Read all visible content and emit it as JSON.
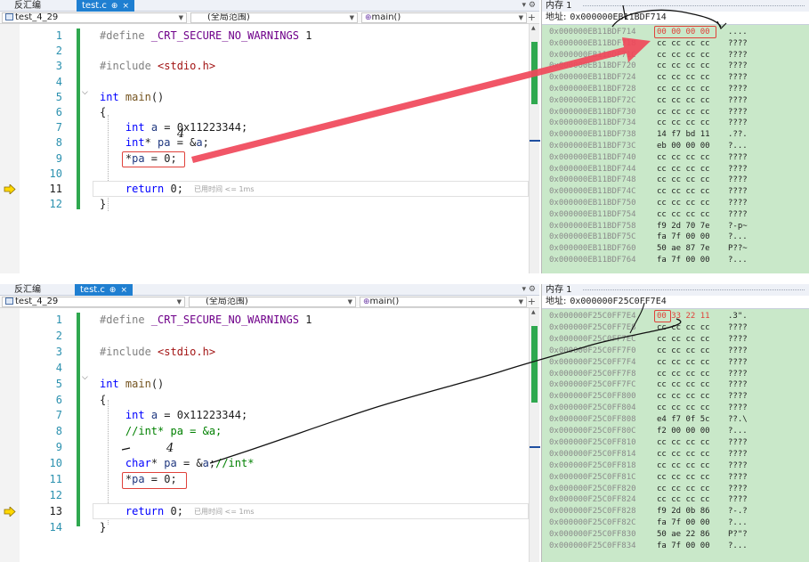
{
  "panels": [
    {
      "tabs": {
        "left_label": "反汇编",
        "file_label": "test.c",
        "pin_glyph": "⊕",
        "close_glyph": "×"
      },
      "nav": {
        "project": "test_4_29",
        "scope": "(全局范围)",
        "function": "main()"
      },
      "lines": [
        {
          "n": "1",
          "segments": [
            [
              "pp",
              "#define "
            ],
            [
              "mac",
              "_CRT_SECURE_NO_WARNINGS"
            ],
            [
              "plain",
              " 1"
            ]
          ]
        },
        {
          "n": "2",
          "segments": []
        },
        {
          "n": "3",
          "segments": [
            [
              "pp",
              "#include "
            ],
            [
              "inc",
              "<stdio.h>"
            ]
          ]
        },
        {
          "n": "4",
          "segments": []
        },
        {
          "n": "5",
          "segments": [
            [
              "kw",
              "int"
            ],
            [
              "plain",
              " "
            ],
            [
              "fn",
              "main"
            ],
            [
              "plain",
              "()"
            ]
          ]
        },
        {
          "n": "6",
          "segments": [
            [
              "plain",
              "{"
            ]
          ]
        },
        {
          "n": "7",
          "segments": [
            [
              "plain",
              "    "
            ],
            [
              "kw",
              "int"
            ],
            [
              "plain",
              " "
            ],
            [
              "var",
              "a"
            ],
            [
              "plain",
              " = 0x11223344;"
            ]
          ]
        },
        {
          "n": "8",
          "segments": [
            [
              "plain",
              "    "
            ],
            [
              "kw",
              "int"
            ],
            [
              "plain",
              "* "
            ],
            [
              "var",
              "pa"
            ],
            [
              "plain",
              " = &"
            ],
            [
              "var",
              "a"
            ],
            [
              "plain",
              ";"
            ]
          ]
        },
        {
          "n": "9",
          "segments": [
            [
              "plain",
              "    *"
            ],
            [
              "var",
              "pa"
            ],
            [
              "plain",
              " = 0;"
            ]
          ]
        },
        {
          "n": "10",
          "segments": []
        },
        {
          "n": "11",
          "segments": [
            [
              "plain",
              "    "
            ],
            [
              "kw",
              "return"
            ],
            [
              "plain",
              " 0;"
            ]
          ],
          "hint": "已用时间 <= 1ms"
        },
        {
          "n": "12",
          "segments": [
            [
              "plain",
              "}"
            ]
          ]
        }
      ],
      "memory": {
        "title": "内存 1",
        "address_label": "地址:",
        "address": "0x000000EB11BDF714",
        "rows": [
          {
            "addr": "0x000000EB11BDF714",
            "bytes": "00 00 00 00",
            "chars": "...."
          },
          {
            "addr": "0x000000EB11BDF718",
            "bytes": "cc cc cc cc",
            "chars": "????"
          },
          {
            "addr": "0x000000EB11BDF71C",
            "bytes": "cc cc cc cc",
            "chars": "????"
          },
          {
            "addr": "0x000000EB11BDF720",
            "bytes": "cc cc cc cc",
            "chars": "????"
          },
          {
            "addr": "0x000000EB11BDF724",
            "bytes": "cc cc cc cc",
            "chars": "????"
          },
          {
            "addr": "0x000000EB11BDF728",
            "bytes": "cc cc cc cc",
            "chars": "????"
          },
          {
            "addr": "0x000000EB11BDF72C",
            "bytes": "cc cc cc cc",
            "chars": "????"
          },
          {
            "addr": "0x000000EB11BDF730",
            "bytes": "cc cc cc cc",
            "chars": "????"
          },
          {
            "addr": "0x000000EB11BDF734",
            "bytes": "cc cc cc cc",
            "chars": "????"
          },
          {
            "addr": "0x000000EB11BDF738",
            "bytes": "14 f7 bd 11",
            "chars": ".??."
          },
          {
            "addr": "0x000000EB11BDF73C",
            "bytes": "eb 00 00 00",
            "chars": "?..."
          },
          {
            "addr": "0x000000EB11BDF740",
            "bytes": "cc cc cc cc",
            "chars": "????"
          },
          {
            "addr": "0x000000EB11BDF744",
            "bytes": "cc cc cc cc",
            "chars": "????"
          },
          {
            "addr": "0x000000EB11BDF748",
            "bytes": "cc cc cc cc",
            "chars": "????"
          },
          {
            "addr": "0x000000EB11BDF74C",
            "bytes": "cc cc cc cc",
            "chars": "????"
          },
          {
            "addr": "0x000000EB11BDF750",
            "bytes": "cc cc cc cc",
            "chars": "????"
          },
          {
            "addr": "0x000000EB11BDF754",
            "bytes": "cc cc cc cc",
            "chars": "????"
          },
          {
            "addr": "0x000000EB11BDF758",
            "bytes": "f9 2d 70 7e",
            "chars": "?-p~"
          },
          {
            "addr": "0x000000EB11BDF75C",
            "bytes": "fa 7f 00 00",
            "chars": "?..."
          },
          {
            "addr": "0x000000EB11BDF760",
            "bytes": "50 ae 87 7e",
            "chars": "P??~"
          },
          {
            "addr": "0x000000EB11BDF764",
            "bytes": "fa 7f 00 00",
            "chars": "?..."
          }
        ]
      },
      "annotation_digit": "4"
    },
    {
      "tabs": {
        "left_label": "反汇编",
        "file_label": "test.c",
        "pin_glyph": "⊕",
        "close_glyph": "×"
      },
      "nav": {
        "project": "test_4_29",
        "scope": "(全局范围)",
        "function": "main()"
      },
      "lines": [
        {
          "n": "1",
          "segments": [
            [
              "pp",
              "#define "
            ],
            [
              "mac",
              "_CRT_SECURE_NO_WARNINGS"
            ],
            [
              "plain",
              " 1"
            ]
          ]
        },
        {
          "n": "2",
          "segments": []
        },
        {
          "n": "3",
          "segments": [
            [
              "pp",
              "#include "
            ],
            [
              "inc",
              "<stdio.h>"
            ]
          ]
        },
        {
          "n": "4",
          "segments": []
        },
        {
          "n": "5",
          "segments": [
            [
              "kw",
              "int"
            ],
            [
              "plain",
              " "
            ],
            [
              "fn",
              "main"
            ],
            [
              "plain",
              "()"
            ]
          ]
        },
        {
          "n": "6",
          "segments": [
            [
              "plain",
              "{"
            ]
          ]
        },
        {
          "n": "7",
          "segments": [
            [
              "plain",
              "    "
            ],
            [
              "kw",
              "int"
            ],
            [
              "plain",
              " "
            ],
            [
              "var",
              "a"
            ],
            [
              "plain",
              " = 0x11223344;"
            ]
          ]
        },
        {
          "n": "8",
          "segments": [
            [
              "plain",
              "    "
            ],
            [
              "cm",
              "//int* pa = &a;"
            ]
          ]
        },
        {
          "n": "9",
          "segments": []
        },
        {
          "n": "10",
          "segments": [
            [
              "plain",
              "    "
            ],
            [
              "kw",
              "char"
            ],
            [
              "plain",
              "* "
            ],
            [
              "var",
              "pa"
            ],
            [
              "plain",
              " = &"
            ],
            [
              "var",
              "a"
            ],
            [
              "plain",
              ";"
            ],
            [
              "cm",
              "//int*"
            ]
          ]
        },
        {
          "n": "11",
          "segments": [
            [
              "plain",
              "    *"
            ],
            [
              "var",
              "pa"
            ],
            [
              "plain",
              " = 0;"
            ]
          ]
        },
        {
          "n": "12",
          "segments": []
        },
        {
          "n": "13",
          "segments": [
            [
              "plain",
              "    "
            ],
            [
              "kw",
              "return"
            ],
            [
              "plain",
              " 0;"
            ]
          ],
          "hint": "已用时间 <= 1ms"
        },
        {
          "n": "14",
          "segments": [
            [
              "plain",
              "}"
            ]
          ]
        }
      ],
      "memory": {
        "title": "内存 1",
        "address_label": "地址:",
        "address": "0x000000F25C0FF7E4",
        "rows": [
          {
            "addr": "0x000000F25C0FF7E4",
            "bytes": "00 33 22 11",
            "chars": ".3\"."
          },
          {
            "addr": "0x000000F25C0FF7E8",
            "bytes": "cc cc cc cc",
            "chars": "????"
          },
          {
            "addr": "0x000000F25C0FF7EC",
            "bytes": "cc cc cc cc",
            "chars": "????"
          },
          {
            "addr": "0x000000F25C0FF7F0",
            "bytes": "cc cc cc cc",
            "chars": "????"
          },
          {
            "addr": "0x000000F25C0FF7F4",
            "bytes": "cc cc cc cc",
            "chars": "????"
          },
          {
            "addr": "0x000000F25C0FF7F8",
            "bytes": "cc cc cc cc",
            "chars": "????"
          },
          {
            "addr": "0x000000F25C0FF7FC",
            "bytes": "cc cc cc cc",
            "chars": "????"
          },
          {
            "addr": "0x000000F25C0FF800",
            "bytes": "cc cc cc cc",
            "chars": "????"
          },
          {
            "addr": "0x000000F25C0FF804",
            "bytes": "cc cc cc cc",
            "chars": "????"
          },
          {
            "addr": "0x000000F25C0FF808",
            "bytes": "e4 f7 0f 5c",
            "chars": "??.\\"
          },
          {
            "addr": "0x000000F25C0FF80C",
            "bytes": "f2 00 00 00",
            "chars": "?..."
          },
          {
            "addr": "0x000000F25C0FF810",
            "bytes": "cc cc cc cc",
            "chars": "????"
          },
          {
            "addr": "0x000000F25C0FF814",
            "bytes": "cc cc cc cc",
            "chars": "????"
          },
          {
            "addr": "0x000000F25C0FF818",
            "bytes": "cc cc cc cc",
            "chars": "????"
          },
          {
            "addr": "0x000000F25C0FF81C",
            "bytes": "cc cc cc cc",
            "chars": "????"
          },
          {
            "addr": "0x000000F25C0FF820",
            "bytes": "cc cc cc cc",
            "chars": "????"
          },
          {
            "addr": "0x000000F25C0FF824",
            "bytes": "cc cc cc cc",
            "chars": "????"
          },
          {
            "addr": "0x000000F25C0FF828",
            "bytes": "f9 2d 0b 86",
            "chars": "?-.?"
          },
          {
            "addr": "0x000000F25C0FF82C",
            "bytes": "fa 7f 00 00",
            "chars": "?..."
          },
          {
            "addr": "0x000000F25C0FF830",
            "bytes": "50 ae 22 86",
            "chars": "P?\"?"
          },
          {
            "addr": "0x000000F25C0FF834",
            "bytes": "fa 7f 00 00",
            "chars": "?..."
          }
        ]
      },
      "annotation_digit": "4"
    }
  ],
  "colors": {
    "memory_bg": "#c9e8c9",
    "highlight_red": "#e0413a",
    "active_tab": "#1f7fd1",
    "arrow": "#f0485a"
  },
  "icons": {
    "execution_pointer": "yellow-arrow-icon",
    "nav_project": "project-icon",
    "nav_function": "function-icon",
    "pin": "pin-icon",
    "close": "close-icon"
  }
}
